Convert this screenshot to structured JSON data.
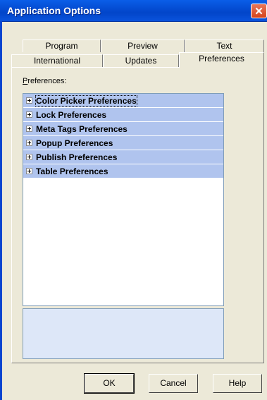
{
  "window": {
    "title": "Application Options",
    "close_glyph": "✕"
  },
  "tabs": {
    "row1": [
      {
        "label": "Program"
      },
      {
        "label": "Preview"
      },
      {
        "label": "Text"
      }
    ],
    "row2": [
      {
        "label": "International"
      },
      {
        "label": "Updates"
      },
      {
        "label": "Preferences",
        "active": true
      }
    ]
  },
  "preferences": {
    "label_accel": "P",
    "label_rest": "references:",
    "items": [
      {
        "label": "Color Picker Preferences"
      },
      {
        "label": "Lock Preferences"
      },
      {
        "label": "Meta Tags Preferences"
      },
      {
        "label": "Popup Preferences"
      },
      {
        "label": "Publish Preferences"
      },
      {
        "label": "Table Preferences"
      }
    ]
  },
  "buttons": {
    "ok": "OK",
    "cancel": "Cancel",
    "help": "Help"
  }
}
